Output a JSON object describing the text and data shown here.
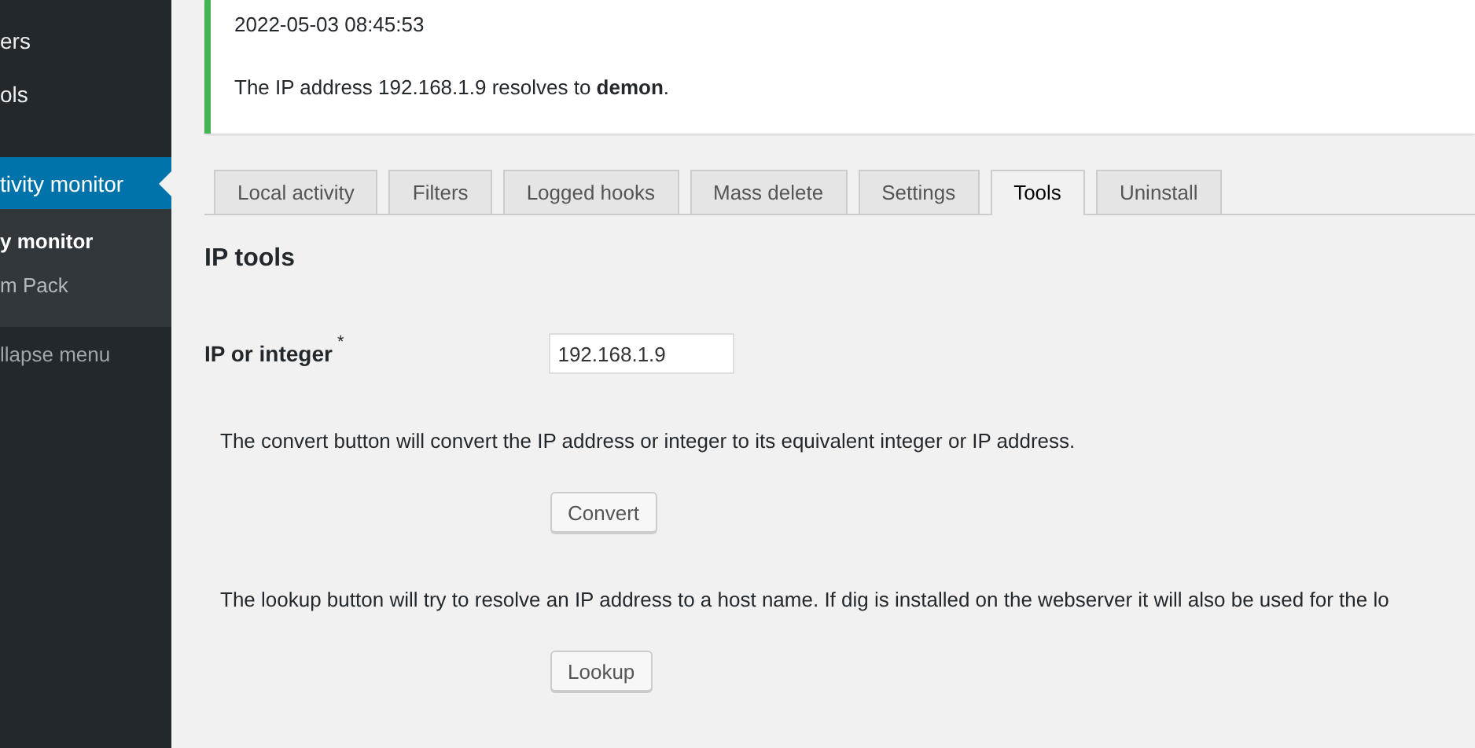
{
  "sidebar": {
    "items": [
      {
        "label": "ers",
        "selected": false
      },
      {
        "label": "ols",
        "selected": false
      },
      {
        "label": "tivity monitor",
        "selected": true,
        "children": [
          {
            "label": "y monitor",
            "selected": true
          },
          {
            "label": "m Pack",
            "selected": false
          }
        ]
      }
    ],
    "collapse": "llapse menu"
  },
  "notice": {
    "timestamp": "2022-05-03 08:45:53",
    "message": "The IP address 192.168.1.9 resolves to **demon**."
  },
  "tabs": [
    {
      "label": "Local activity",
      "selected": false
    },
    {
      "label": "Filters",
      "selected": false
    },
    {
      "label": "Logged hooks",
      "selected": false
    },
    {
      "label": "Mass delete",
      "selected": false
    },
    {
      "label": "Settings",
      "selected": false
    },
    {
      "label": "Tools",
      "selected": true
    },
    {
      "label": "Uninstall",
      "selected": false
    }
  ],
  "heading": "IP tools",
  "field": {
    "label": "IP or integer",
    "required_mark": "*",
    "value": "192.168.1.9"
  },
  "sections": [
    {
      "description": "The convert button will convert the IP address or integer to its equivalent integer or IP address.",
      "button": "Convert"
    },
    {
      "description": "The lookup button will try to resolve an IP address to a host name. If dig is installed on the webserver it will also be used for the lo",
      "button": "Lookup"
    }
  ]
}
